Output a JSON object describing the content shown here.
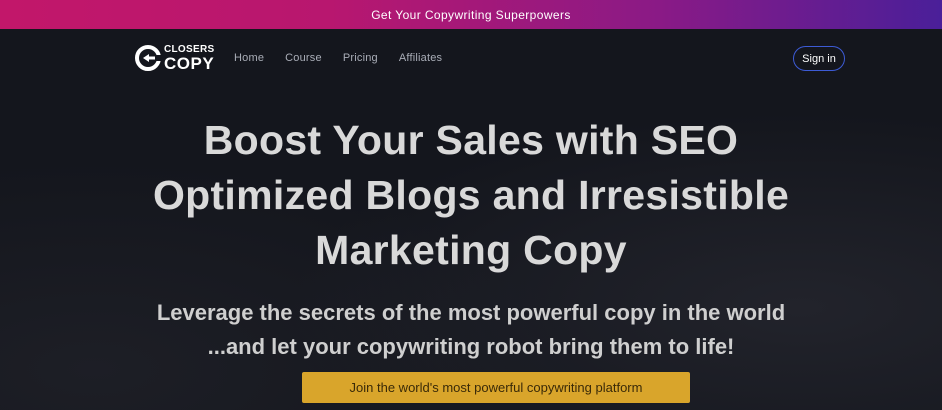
{
  "promo": {
    "text": "Get Your Copywriting Superpowers"
  },
  "nav": {
    "logo": {
      "line1": "CLOSERS",
      "line2": "COPY",
      "icon": "closerscopy-logo-icon"
    },
    "links": [
      {
        "label": "Home"
      },
      {
        "label": "Course"
      },
      {
        "label": "Pricing"
      },
      {
        "label": "Affiliates"
      }
    ],
    "sign_in_label": "Sign in"
  },
  "hero": {
    "title_lines": [
      "Boost Your Sales with SEO",
      "Optimized Blogs and Irresistible",
      "Marketing Copy"
    ],
    "subtitle_lines": [
      "Leverage the secrets of the most powerful copy in the world",
      "...and let your copywriting robot bring them to life!"
    ],
    "cta_label": "Join the world's most powerful copywriting platform"
  },
  "colors": {
    "background": "#14161d",
    "promo_gradient_start": "#c2176a",
    "promo_gradient_end": "#4a1f99",
    "cta_background": "#d9a52b",
    "sign_in_border": "#3d5bd6",
    "title_text": "#d9d9d9"
  }
}
